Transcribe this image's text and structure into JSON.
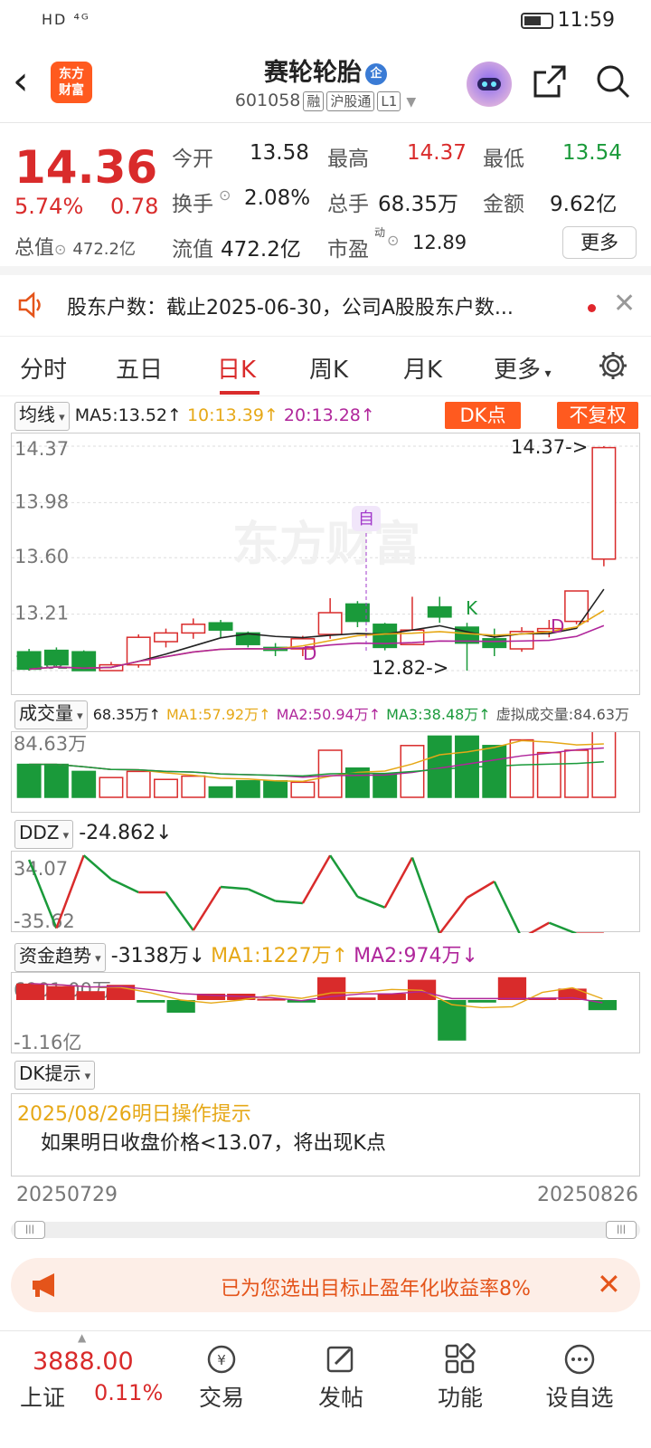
{
  "status": {
    "signal": "HD ⁴ᴳ",
    "time": "11:59"
  },
  "header": {
    "logo": "东方\n财富",
    "title": "赛轮轮胎",
    "title_badge": "企",
    "code": "601058",
    "tags": [
      "融",
      "沪股通",
      "L1"
    ]
  },
  "quote": {
    "price": "14.36",
    "pct": "5.74%",
    "change": "0.78",
    "open_label": "今开",
    "open": "13.58",
    "high_label": "最高",
    "high": "14.37",
    "low_label": "最低",
    "low": "13.54",
    "turnover_label": "换手",
    "turnover": "2.08%",
    "volume_label": "总手",
    "volume": "68.35万",
    "amount_label": "金额",
    "amount": "9.62亿",
    "mktcap_label": "总值",
    "mktcap": "472.2亿",
    "float_label": "流值",
    "float": "472.2亿",
    "pe_label": "市盈",
    "pe_sup": "动",
    "pe": "12.89",
    "more": "更多"
  },
  "notice": {
    "text": "股东户数：截止2025-06-30，公司A股股东户数..."
  },
  "tabs": [
    "分时",
    "五日",
    "日K",
    "周K",
    "月K",
    "更多"
  ],
  "active_tab": "日K",
  "ma": {
    "selector": "均线",
    "ma5": "MA5:13.52↑",
    "ma10": "10:13.39↑",
    "ma20": "20:13.28↑",
    "dk_btn": "DK点",
    "adjust_btn": "不复权"
  },
  "kline": {
    "axis": [
      "14.37",
      "13.98",
      "13.60",
      "13.21",
      "12.82"
    ],
    "high_label": "14.37->",
    "low_label": "12.82->",
    "marks": {
      "zi": "自",
      "K": "K",
      "D": "D"
    },
    "watermark": "东方财富",
    "candles": [
      {
        "o": 12.95,
        "c": 12.83,
        "h": 12.97,
        "l": 12.82,
        "up": false
      },
      {
        "o": 12.96,
        "c": 12.86,
        "h": 12.98,
        "l": 12.84,
        "up": false
      },
      {
        "o": 12.95,
        "c": 12.82,
        "h": 12.96,
        "l": 12.82,
        "up": false
      },
      {
        "o": 12.82,
        "c": 12.86,
        "h": 12.88,
        "l": 12.82,
        "up": true
      },
      {
        "o": 12.86,
        "c": 13.05,
        "h": 13.07,
        "l": 12.84,
        "up": true
      },
      {
        "o": 13.02,
        "c": 13.08,
        "h": 13.11,
        "l": 12.98,
        "up": true
      },
      {
        "o": 13.08,
        "c": 13.14,
        "h": 13.18,
        "l": 13.04,
        "up": true
      },
      {
        "o": 13.15,
        "c": 13.1,
        "h": 13.17,
        "l": 13.05,
        "up": false
      },
      {
        "o": 13.08,
        "c": 13.0,
        "h": 13.09,
        "l": 12.98,
        "up": false
      },
      {
        "o": 12.98,
        "c": 12.96,
        "h": 13.01,
        "l": 12.92,
        "up": false
      },
      {
        "o": 12.97,
        "c": 13.04,
        "h": 13.06,
        "l": 12.92,
        "up": true
      },
      {
        "o": 13.07,
        "c": 13.22,
        "h": 13.32,
        "l": 13.04,
        "up": true
      },
      {
        "o": 13.28,
        "c": 13.16,
        "h": 13.3,
        "l": 13.12,
        "up": false
      },
      {
        "o": 13.14,
        "c": 12.98,
        "h": 13.15,
        "l": 12.96,
        "up": false
      },
      {
        "o": 13.0,
        "c": 13.1,
        "h": 13.33,
        "l": 13.0,
        "up": true
      },
      {
        "o": 13.26,
        "c": 13.19,
        "h": 13.33,
        "l": 13.15,
        "up": false
      },
      {
        "o": 13.12,
        "c": 13.01,
        "h": 13.15,
        "l": 12.82,
        "up": false
      },
      {
        "o": 13.04,
        "c": 12.98,
        "h": 13.11,
        "l": 12.92,
        "up": false
      },
      {
        "o": 12.97,
        "c": 13.09,
        "h": 13.12,
        "l": 12.95,
        "up": true
      },
      {
        "o": 13.09,
        "c": 13.11,
        "h": 13.17,
        "l": 13.05,
        "up": true
      },
      {
        "o": 13.16,
        "c": 13.37,
        "h": 13.37,
        "l": 13.14,
        "up": true
      },
      {
        "o": 13.59,
        "c": 14.36,
        "h": 14.37,
        "l": 13.54,
        "up": true
      }
    ]
  },
  "volume": {
    "selector": "成交量",
    "value": "68.35万↑",
    "ma1": "MA1:57.92万↑",
    "ma2": "MA2:50.94万↑",
    "ma3": "MA3:38.48万↑",
    "virtual": "虚拟成交量:84.63万",
    "axis_top": "84.63万",
    "bars": [
      0.7,
      0.7,
      0.55,
      0.42,
      0.55,
      0.38,
      0.45,
      0.22,
      0.35,
      0.35,
      0.32,
      1.0,
      0.62,
      0.5,
      1.1,
      1.3,
      1.3,
      1.1,
      1.22,
      0.95,
      1.0,
      1.4
    ]
  },
  "ddz": {
    "selector": "DDZ",
    "value": "-24.862↓",
    "axis_top": "34.07",
    "axis_bottom": "-35.62",
    "points": [
      30,
      -33,
      34,
      12,
      0,
      0,
      -35,
      5,
      3,
      -8,
      -10,
      34,
      -4,
      -14,
      32,
      -38,
      -5,
      10,
      -42,
      -28,
      -38,
      -38
    ]
  },
  "fund": {
    "selector": "资金趋势",
    "value": "-3138万↓",
    "ma1": "MA1:1227万↑",
    "ma2": "MA2:974万↓",
    "axis_top": "6901.00万",
    "axis_bottom": "-1.16亿",
    "bars": [
      0.65,
      0.55,
      0.35,
      0.6,
      -0.1,
      -0.5,
      0.25,
      0.25,
      0.05,
      -0.1,
      0.9,
      0.1,
      0.25,
      0.8,
      -1.6,
      -0.1,
      0.9,
      0.1,
      0.45,
      -0.4
    ]
  },
  "dk": {
    "selector": "DK提示",
    "line1": "2025/08/26明日操作提示",
    "line2": "如果明日收盘价格<13.07，将出现K点"
  },
  "dates": {
    "start": "20250729",
    "end": "20250826"
  },
  "promo": {
    "text": "已为您选出目标止盈年化收益率8%"
  },
  "bottom": {
    "index_value": "3888.00",
    "index_name": "上证",
    "index_pct": "0.11%",
    "nav": [
      "交易",
      "发帖",
      "功能",
      "设自选"
    ]
  },
  "colors": {
    "up": "#d92b2b",
    "down": "#1a9a3a",
    "accent": "#ff5a1f",
    "ma5": "#222222",
    "ma10": "#e6a817",
    "ma20": "#b0269b"
  }
}
